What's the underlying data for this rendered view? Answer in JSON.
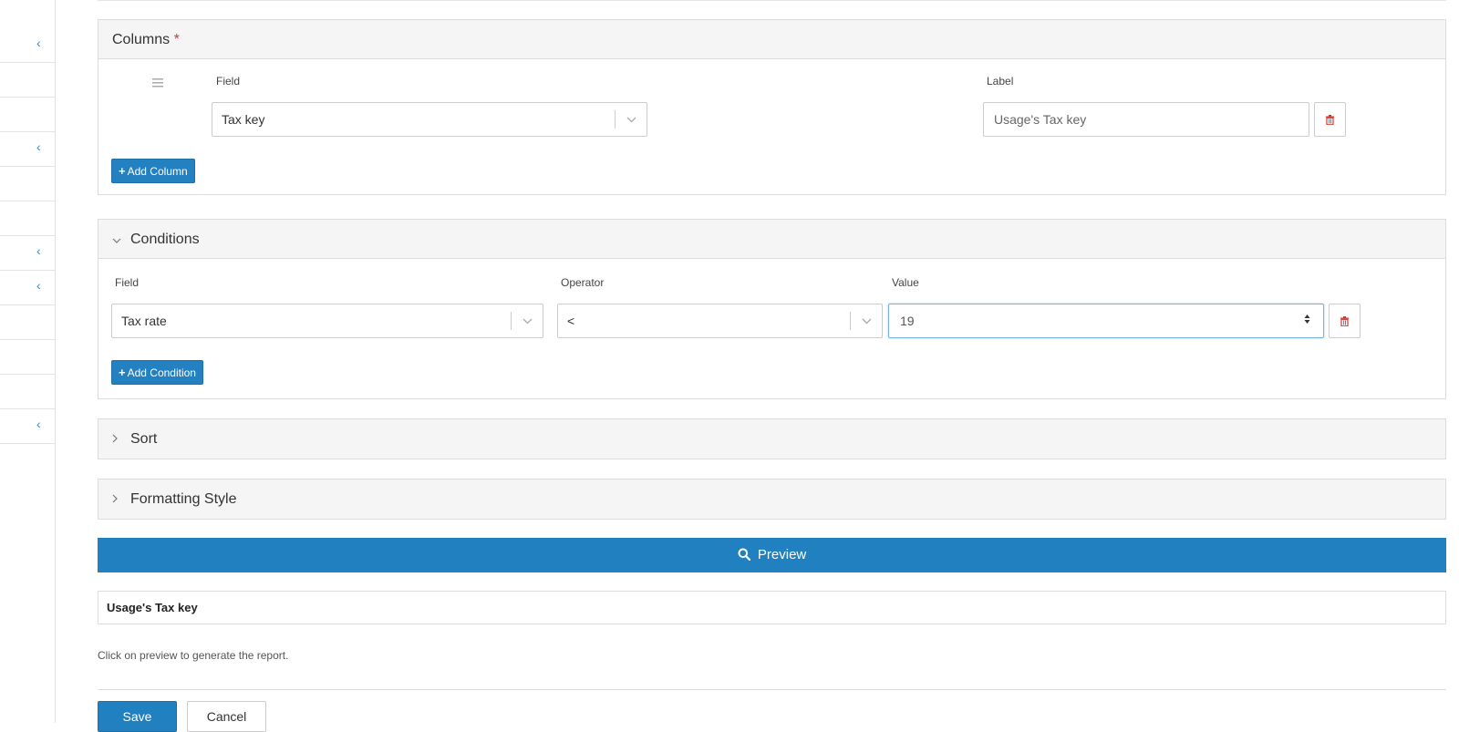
{
  "sidebar": {
    "rows": [
      {
        "has_chevron": true
      },
      {
        "has_chevron": false
      },
      {
        "has_chevron": false
      },
      {
        "has_chevron": true
      },
      {
        "has_chevron": false
      },
      {
        "has_chevron": false
      },
      {
        "has_chevron": true
      },
      {
        "has_chevron": true
      },
      {
        "has_chevron": false
      },
      {
        "has_chevron": false
      },
      {
        "has_chevron": false
      },
      {
        "has_chevron": true
      }
    ],
    "chevron_glyph": "‹",
    "accent_color": "#2a8fd4"
  },
  "columns": {
    "title": "Columns",
    "required_mark": "*",
    "field_label": "Field",
    "label_label": "Label",
    "field_value": "Tax key",
    "label_placeholder": "Usage's Tax key",
    "add_button": "Add Column",
    "add_icon": "+"
  },
  "conditions": {
    "title": "Conditions",
    "caret": "⌄",
    "field_label": "Field",
    "operator_label": "Operator",
    "value_label": "Value",
    "field_value": "Tax rate",
    "operator_value": "<",
    "value_value": "19",
    "add_button": "Add Condition",
    "add_icon": "+"
  },
  "sort": {
    "title": "Sort",
    "caret": "›"
  },
  "formatting": {
    "title": "Formatting Style",
    "caret": "›"
  },
  "preview": {
    "label": "Preview",
    "color": "#2180c0"
  },
  "result": {
    "column_header": "Usage's Tax key",
    "note": "Click on preview to generate the report."
  },
  "actions": {
    "save": "Save",
    "cancel": "Cancel"
  },
  "colors": {
    "primary": "#2180c0",
    "danger": "#d9352a"
  }
}
